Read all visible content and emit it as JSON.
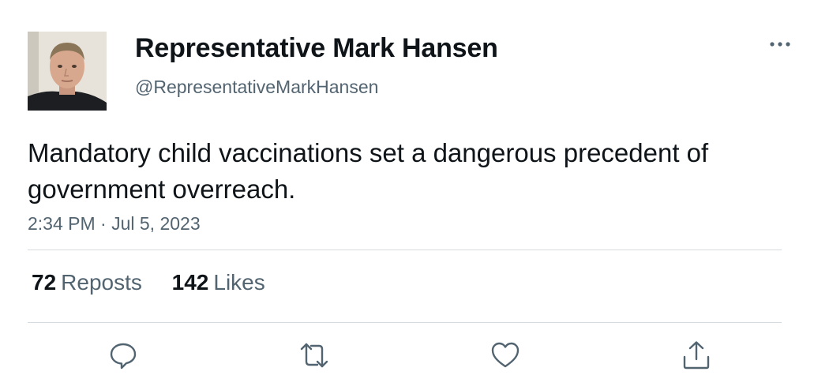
{
  "author": {
    "display_name": "Representative Mark Hansen",
    "handle": "@RepresentativeMarkHansen"
  },
  "tweet": {
    "text": "Mandatory child vaccinations set a dangerous precedent of government overreach.",
    "timestamp": "2:34 PM · Jul 5, 2023"
  },
  "stats": {
    "reposts_count": "72",
    "reposts_label": "Reposts",
    "likes_count": "142",
    "likes_label": "Likes"
  },
  "actions": {
    "reply_icon": "reply-icon",
    "repost_icon": "repost-icon",
    "like_icon": "heart-icon",
    "share_icon": "share-icon"
  },
  "colors": {
    "text_primary": "#0f1419",
    "text_secondary": "#536471",
    "divider": "#d6dbdf"
  }
}
